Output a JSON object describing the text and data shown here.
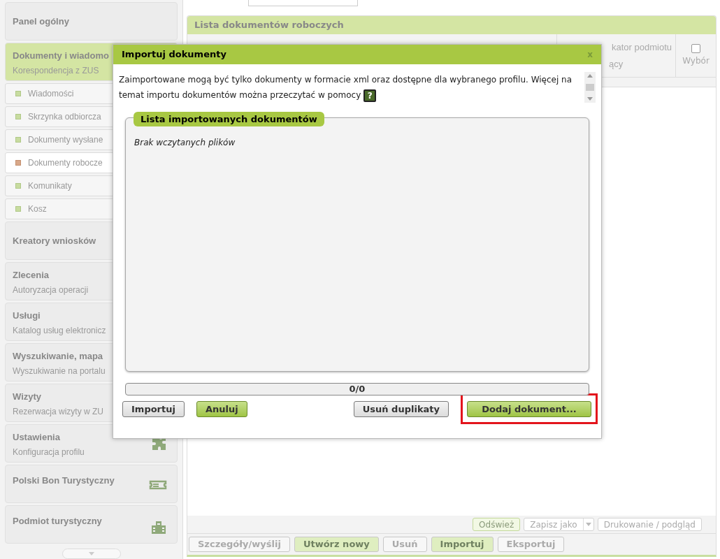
{
  "sidebar": {
    "items": [
      {
        "kind": "section",
        "title": "Panel ogólny",
        "active": false
      },
      {
        "kind": "section",
        "title": "Dokumenty i wiadomo",
        "subtitle": "Korespondencja z ZUS",
        "active": true
      },
      {
        "kind": "sub",
        "label": "Wiadomości",
        "selected": false
      },
      {
        "kind": "sub",
        "label": "Skrzynka odbiorcza",
        "selected": false
      },
      {
        "kind": "sub",
        "label": "Dokumenty wysłane",
        "selected": false
      },
      {
        "kind": "sub",
        "label": "Dokumenty robocze",
        "selected": true
      },
      {
        "kind": "sub",
        "label": "Komunikaty",
        "selected": false
      },
      {
        "kind": "sub",
        "label": "Kosz",
        "selected": false
      },
      {
        "kind": "section",
        "title": "Kreatory wniosków",
        "active": false
      },
      {
        "kind": "section",
        "title": "Zlecenia",
        "subtitle": "Autoryzacja operacji",
        "active": false
      },
      {
        "kind": "section",
        "title": "Usługi",
        "subtitle": "Katalog usług elektronicz",
        "active": false
      },
      {
        "kind": "section",
        "title": "Wyszukiwanie, mapa",
        "subtitle": "Wyszukiwanie na portalu",
        "active": false
      },
      {
        "kind": "section",
        "title": "Wizyty",
        "subtitle": "Rezerwacja wizyty w ZU",
        "active": false
      },
      {
        "kind": "section",
        "title": "Ustawienia",
        "subtitle": "Konfiguracja profilu",
        "active": false
      },
      {
        "kind": "section",
        "title": "Polski Bon Turystyczny",
        "active": false
      },
      {
        "kind": "section",
        "title": "Podmiot turystyczny",
        "active": false
      }
    ]
  },
  "panel": {
    "title": "Lista dokumentów roboczych",
    "columns": [
      "kator podmiotu",
      "ący"
    ],
    "select_column": {
      "label": "Wybór",
      "checked": false
    },
    "toolbar": [
      {
        "label": "Odśwież",
        "kind": "green"
      },
      {
        "label": "Zapisz jako",
        "kind": "split"
      },
      {
        "label": "Drukowanie / podgląd",
        "kind": "plain"
      }
    ],
    "actions": [
      {
        "label": "Szczegóły/wyślij",
        "kind": "plain"
      },
      {
        "label": "Utwórz nowy",
        "kind": "green"
      },
      {
        "label": "Usuń",
        "kind": "plain"
      },
      {
        "label": "Importuj",
        "kind": "green"
      },
      {
        "label": "Eksportuj",
        "kind": "plain"
      }
    ]
  },
  "dialog": {
    "title": "Importuj dokumenty",
    "close": "x",
    "info": "Zaimportowane mogą być tylko dokumenty w formacie xml oraz dostępne dla wybranego profilu. Więcej na temat importu dokumentów można przeczytać w pomocy",
    "help": "?",
    "list_title": "Lista importowanych dokumentów",
    "empty": "Brak wczytanych plików",
    "progress": {
      "label": "0/0",
      "level": 0
    },
    "buttons": [
      {
        "label": "Importuj",
        "kind": "plain",
        "highlighted": false
      },
      {
        "label": "Anuluj",
        "kind": "green",
        "highlighted": false
      },
      {
        "label": "Usuń duplikaty",
        "kind": "plain",
        "highlighted": false
      },
      {
        "label": "Dodaj dokument...",
        "kind": "green",
        "highlighted": true
      }
    ]
  }
}
